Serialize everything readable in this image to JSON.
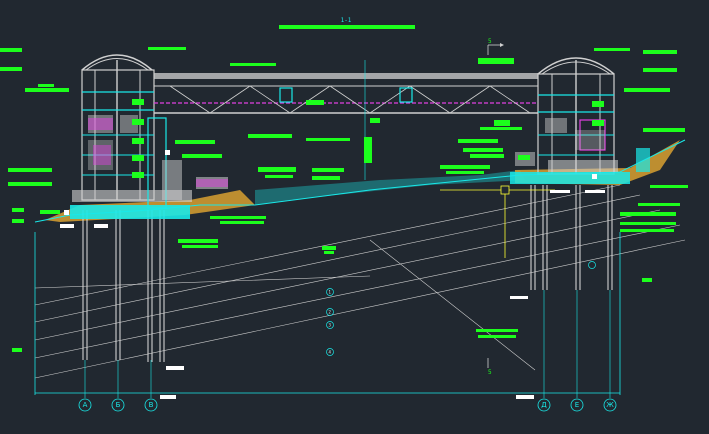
{
  "section_title": "1-1",
  "section_mark_top": "5",
  "section_mark_bottom": "5",
  "axis_labels": [
    "A",
    "Б",
    "В",
    "Д",
    "Е",
    "Ж"
  ],
  "mid_markers": [
    "1",
    "2",
    "3",
    "4"
  ],
  "colors": {
    "background": "#212830",
    "structure": "#19e8e8",
    "steel": "#d0d0d0",
    "annotation": "#1cff1c",
    "pipe": "#e040e0",
    "soil": "#d8a030",
    "cursor": "#ffff33",
    "marker": "#ffffff"
  }
}
